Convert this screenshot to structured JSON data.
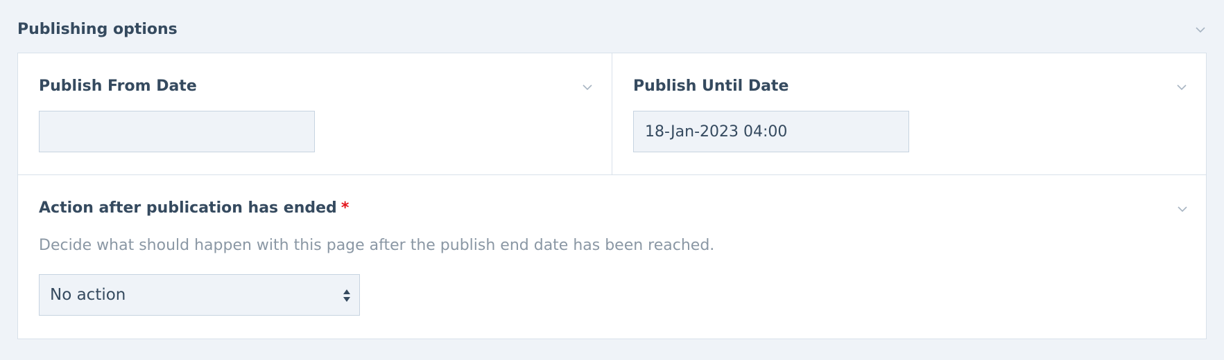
{
  "section": {
    "title": "Publishing options",
    "collapse_icon": "chevron-down-icon"
  },
  "publish_from": {
    "label": "Publish From Date",
    "value": "",
    "placeholder": ""
  },
  "publish_until": {
    "label": "Publish Until Date",
    "value": "18-Jan-2023 04:00",
    "placeholder": ""
  },
  "action_after": {
    "label": "Action after publication has ended",
    "required_marker": "*",
    "help": "Decide what should happen with this page after the publish end date has been reached.",
    "selected": "No action",
    "arrows_icon": "select-arrows-icon"
  },
  "colors": {
    "background": "#eff3f8",
    "panel": "#ffffff",
    "text": "#354a5f",
    "muted": "#8a97a4",
    "required": "#e3141b",
    "border": "#d8e1ea"
  }
}
